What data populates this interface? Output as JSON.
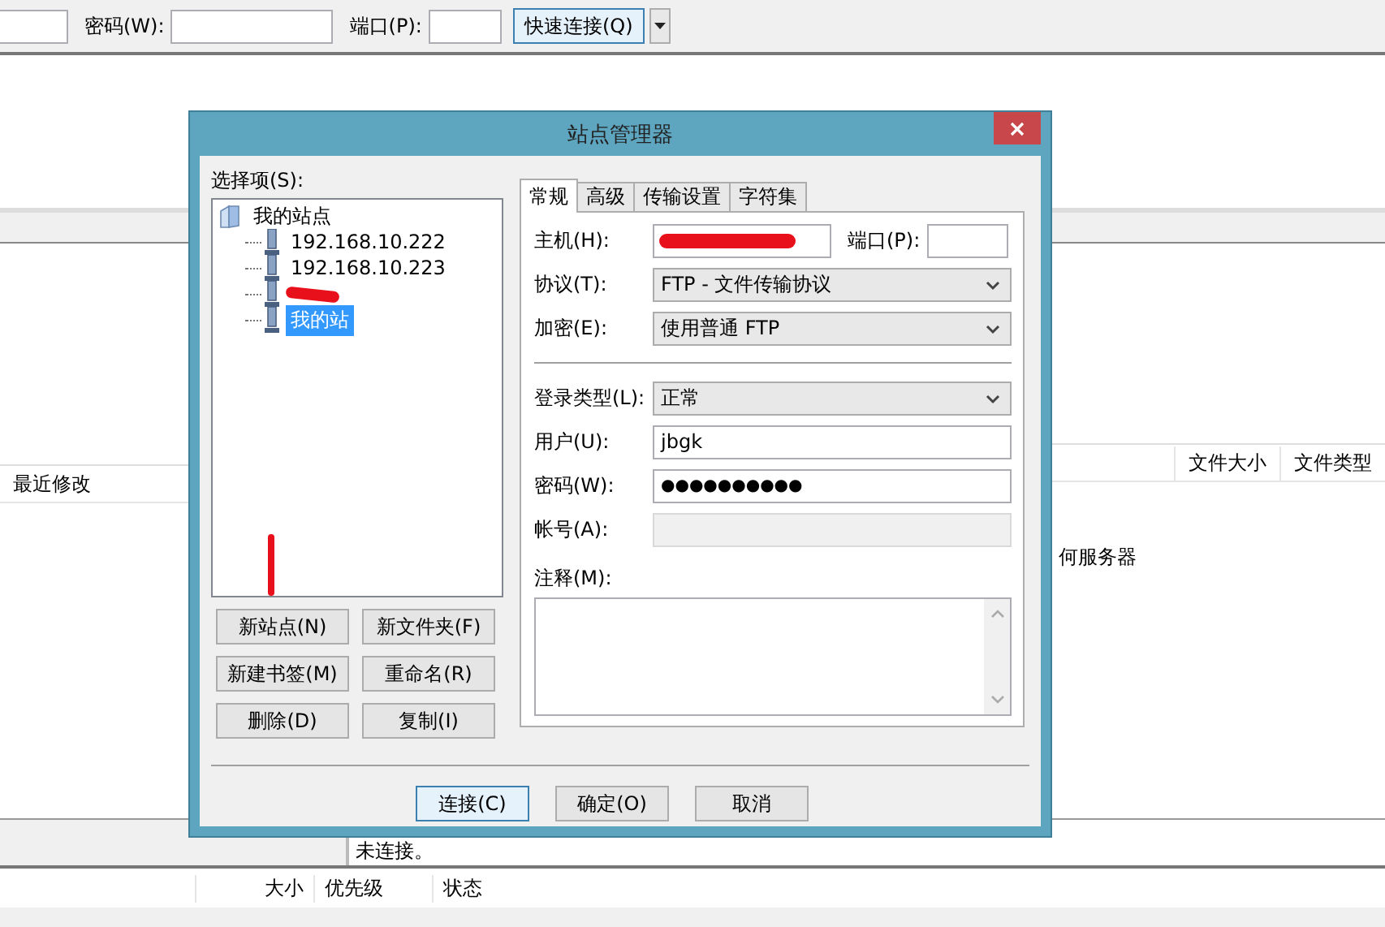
{
  "quickconnect": {
    "password_label": "密码(W):",
    "port_label": "端口(P):",
    "connect_button": "快速连接(Q)"
  },
  "local_panel": {
    "columns": [
      "最近修改"
    ]
  },
  "remote_panel": {
    "columns": [
      "文件大小",
      "文件类型"
    ],
    "message": "何服务器"
  },
  "status_log": {
    "text": "未连接。"
  },
  "queue": {
    "columns": [
      "大小",
      "优先级",
      "状态"
    ]
  },
  "dialog": {
    "title": "站点管理器",
    "tree_label": "选择项(S):",
    "tree": [
      {
        "label": "我的站点",
        "kind": "folder",
        "selected": false,
        "children": [
          {
            "label": "192.168.10.222",
            "kind": "site",
            "selected": false
          },
          {
            "label": "192.168.10.223",
            "kind": "site",
            "selected": false
          },
          {
            "kind": "redacted",
            "selected": false
          },
          {
            "label": "我的站",
            "kind": "site",
            "selected": true
          }
        ]
      }
    ],
    "site_buttons": [
      "新站点(N)",
      "新文件夹(F)",
      "新建书签(M)",
      "重命名(R)",
      "删除(D)",
      "复制(I)"
    ],
    "tabs": [
      {
        "label": "常规",
        "selected": true
      },
      {
        "label": "高级",
        "selected": false
      },
      {
        "label": "传输设置",
        "selected": false
      },
      {
        "label": "字符集",
        "selected": false
      }
    ],
    "general": {
      "host": {
        "label": "主机(H):",
        "redacted": true
      },
      "port_label": "端口(P):",
      "protocol": {
        "label": "协议(T):",
        "value": "FTP - 文件传输协议"
      },
      "encryption": {
        "label": "加密(E):",
        "value": "使用普通 FTP"
      },
      "logon_type": {
        "label": "登录类型(L):",
        "value": "正常"
      },
      "user": {
        "label": "用户(U):",
        "value": "jbgk"
      },
      "password": {
        "label": "密码(W):",
        "value": "●●●●●●●●●●"
      },
      "account": {
        "label": "帐号(A):",
        "disabled": true
      },
      "comment_label": "注释(M):"
    },
    "footer_buttons": [
      {
        "label": "连接(C)",
        "default": true
      },
      {
        "label": "确定(O)",
        "default": false
      },
      {
        "label": "取消",
        "default": false
      }
    ]
  }
}
